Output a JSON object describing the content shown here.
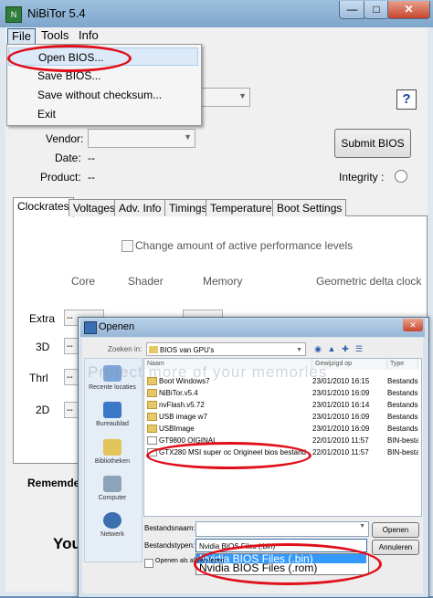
{
  "window": {
    "title": "NiBiTor 5.4",
    "app_icon": "nibitor-icon",
    "buttons": {
      "minimize": "—",
      "maximize": "□",
      "close": "✕"
    }
  },
  "menubar": {
    "file": "File",
    "tools": "Tools",
    "info": "Info"
  },
  "file_menu": {
    "open_bios": "Open BIOS...",
    "save_bios": "Save BIOS...",
    "save_without_checksum": "Save without checksum...",
    "exit": "Exit"
  },
  "info": {
    "vendor_label": "Vendor:",
    "date_label": "Date:",
    "date_value": "--",
    "product_label": "Product:",
    "product_value": "--",
    "submit_button": "Submit BIOS",
    "help_icon": "?",
    "integrity_label": "Integrity :"
  },
  "tabs": [
    "Clockrates",
    "Voltages",
    "Adv. Info",
    "Timings",
    "Temperatures",
    "Boot Settings"
  ],
  "clockrates": {
    "checkbox_label": "Change amount of active performance levels",
    "columns": {
      "core": "Core",
      "shader": "Shader",
      "memory": "Memory",
      "delta": "Geometric delta clock"
    },
    "rows": {
      "extra": "Extra",
      "r3d": "3D",
      "thrl": "Thrl",
      "r2d": "2D"
    },
    "placeholder": "--",
    "remember_label": "Rememder:",
    "partial_text": "You"
  },
  "dialog": {
    "title": "Openen",
    "zoeken_label": "Zoeken in:",
    "zoeken_value": "BIOS van GPU's",
    "places": [
      "Recente locaties",
      "Bureaublad",
      "Bibliotheken",
      "Computer",
      "Netwerk"
    ],
    "columns": {
      "name": "Naam",
      "date": "Gewijzigd op",
      "type": "Type"
    },
    "files": [
      {
        "name": "Boot Windows7",
        "date": "23/01/2010 16:15",
        "type": "Bestandsr"
      },
      {
        "name": "NiBiTor.v5.4",
        "date": "23/01/2010 16:09",
        "type": "Bestandsr"
      },
      {
        "name": "nvFlash.v5.72",
        "date": "23/01/2010 16:14",
        "type": "Bestandsr"
      },
      {
        "name": "USB image w7",
        "date": "23/01/2010 16:09",
        "type": "Bestandsr"
      },
      {
        "name": "USBImage",
        "date": "23/01/2010 16:09",
        "type": "Bestandsr"
      },
      {
        "name": "GT9800 OIGINAL",
        "date": "22/01/2010 11:57",
        "type": "BIN-besta"
      },
      {
        "name": "GTX280 MSI super oc Origineel bios bestand",
        "date": "22/01/2010 11:57",
        "type": "BIN-besta"
      }
    ],
    "watermark": "Protect more of your memories",
    "filename_label": "Bestandsnaam:",
    "filetype_label": "Bestandstypen:",
    "filetype_selected": "Nvidia BIOS Files (.bin)",
    "filetype_options": [
      "Nvidia BIOS Files (.bin)",
      "Nvidia BIOS Files (.rom)"
    ],
    "readonly_label": "Openen als alleen-lezen",
    "open_button": "Openen",
    "cancel_button": "Annuleren"
  },
  "colors": {
    "annotation_red": "#e0101a",
    "titlebar": "#9ec0de",
    "selection": "#3399ff"
  }
}
